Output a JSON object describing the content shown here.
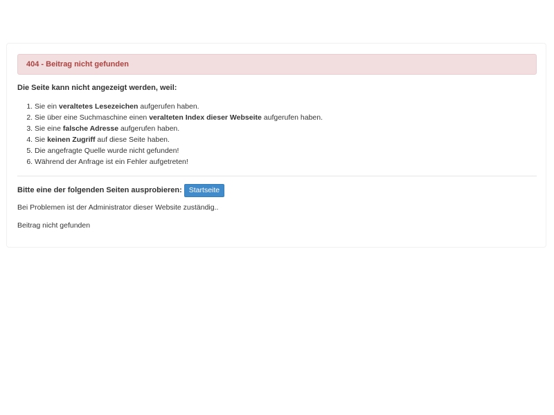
{
  "alert": {
    "title": "404 - Beitrag nicht gefunden"
  },
  "intro": "Die Seite kann nicht angezeigt werden, weil:",
  "reasons": [
    {
      "pre": "Sie ein ",
      "bold": "veraltetes Lesezeichen",
      "post": " aufgerufen haben."
    },
    {
      "pre": "Sie über eine Suchmaschine einen ",
      "bold": "veralteten Index dieser Webseite",
      "post": " aufgerufen haben."
    },
    {
      "pre": "Sie eine ",
      "bold": "falsche Adresse",
      "post": " aufgerufen haben."
    },
    {
      "pre": "Sie ",
      "bold": "keinen Zugriff",
      "post": " auf diese Seite haben."
    },
    {
      "pre": "Die angefragte Quelle wurde nicht gefunden!",
      "bold": "",
      "post": ""
    },
    {
      "pre": "Während der Anfrage ist ein Fehler aufgetreten!",
      "bold": "",
      "post": ""
    }
  ],
  "try_section": {
    "label": "Bitte eine der folgenden Seiten ausprobieren:",
    "button_label": "Startseite"
  },
  "admin_note": "Bei Problemen ist der Administrator dieser Website zuständig..",
  "footer_note": "Beitrag nicht gefunden",
  "colors": {
    "alert_bg": "#f2dede",
    "alert_text": "#a94442",
    "button_bg": "#428bca"
  }
}
